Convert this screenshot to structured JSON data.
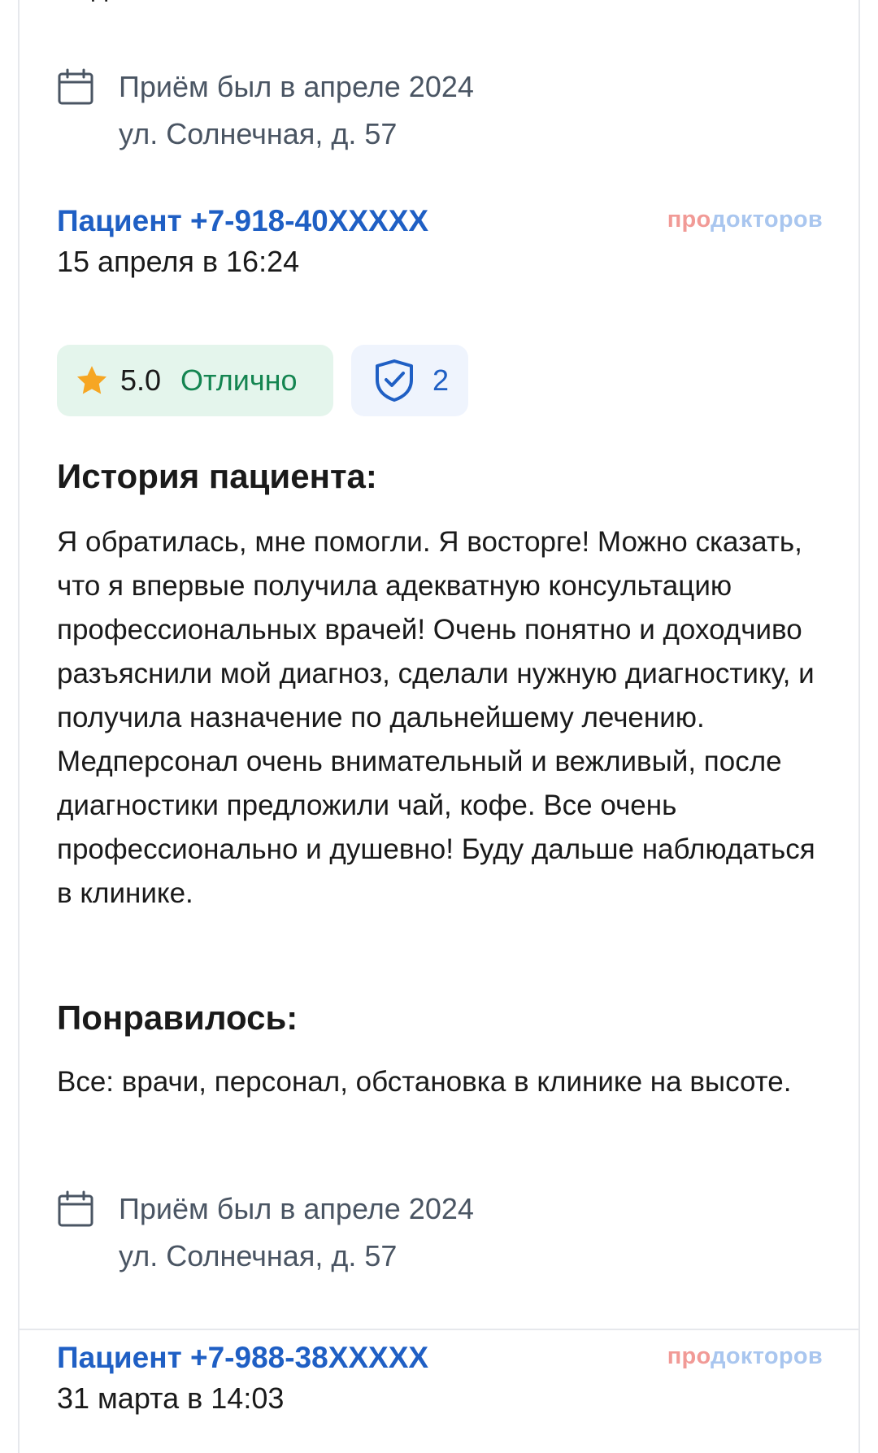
{
  "prev_review": {
    "cut_text": "Недостатков нет.",
    "visit": {
      "icon": "calendar-icon",
      "when": "Приём был в апреле 2024",
      "address": "ул. Солнечная, д. 57"
    }
  },
  "review": {
    "author": "Пациент +7-918-40XXXXX",
    "date": "15 апреля в 16:24",
    "brand_part1": "про",
    "brand_part2": "докторов",
    "rating": {
      "icon": "star-icon",
      "score": "5.0",
      "label": "Отлично",
      "star_color": "#f6a623",
      "bg_color": "#e4f5ec",
      "label_color": "#148551"
    },
    "verified": {
      "icon": "shield-check-icon",
      "count": "2"
    },
    "story_title": "История пациента:",
    "story_text": "Я обратилась, мне помогли. Я восторге! Можно сказать, что я впервые получила адекватную консультацию профессиональных врачей! Очень понятно и доходчиво разъяснили мой диагноз, сделали нужную диагностику, и получила назначение по дальнейшему лечению. Медперсонал очень внимательный и вежливый, после диагностики предложили чай, кофе. Все очень профессионально и душевно! Буду дальше наблюдаться в клинике.",
    "liked_title": "Понравилось:",
    "liked_text": "Все: врачи, персонал, обстановка в клинике на высоте.",
    "visit": {
      "icon": "calendar-icon",
      "when": "Приём был в апреле 2024",
      "address": "ул. Солнечная, д. 57"
    }
  },
  "next_review": {
    "author": "Пациент +7-988-38XXXXX",
    "date": "31 марта в 14:03",
    "brand_part1": "про",
    "brand_part2": "докторов"
  },
  "colors": {
    "link": "#1f5fc4",
    "brand_pink": "#f19a96",
    "brand_blue": "#a9c6ef",
    "muted": "#4a5563"
  }
}
